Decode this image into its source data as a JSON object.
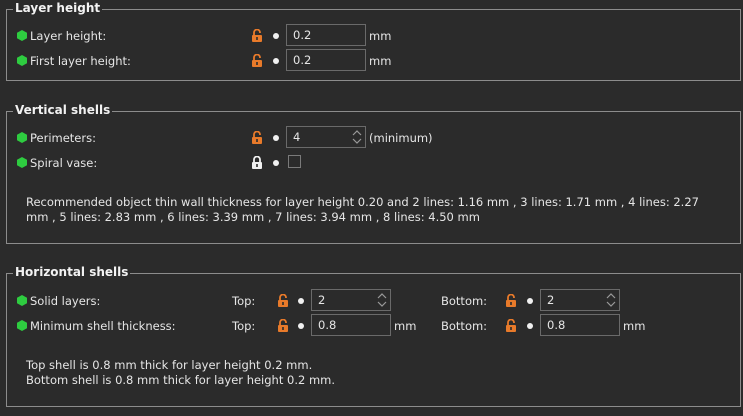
{
  "colors": {
    "accent_green": "#2ecc40",
    "lock_orange": "#e87a2a",
    "lock_white": "#f0f0f0"
  },
  "layer_height": {
    "title": "Layer height",
    "layer_height_label": "Layer height:",
    "layer_height_value": "0.2",
    "layer_height_unit": "mm",
    "first_layer_label": "First layer height:",
    "first_layer_value": "0.2",
    "first_layer_unit": "mm"
  },
  "vertical_shells": {
    "title": "Vertical shells",
    "perimeters_label": "Perimeters:",
    "perimeters_value": "4",
    "perimeters_unit": "(minimum)",
    "spiral_vase_label": "Spiral vase:",
    "note_line1": "Recommended object thin wall thickness for layer height 0.20 and 2 lines: 1.16 mm , 3 lines: 1.71 mm , 4 lines: 2.27",
    "note_line2": "mm , 5 lines: 2.83 mm , 6 lines: 3.39 mm , 7 lines: 3.94 mm , 8 lines: 4.50 mm"
  },
  "horizontal_shells": {
    "title": "Horizontal shells",
    "solid_layers_label": "Solid layers:",
    "top_label": "Top:",
    "bottom_label": "Bottom:",
    "solid_top_value": "2",
    "solid_bottom_value": "2",
    "min_shell_label": "Minimum shell thickness:",
    "min_top_value": "0.8",
    "min_bottom_value": "0.8",
    "unit": "mm",
    "note_line1": "Top shell is 0.8 mm thick for layer height 0.2 mm.",
    "note_line2": "Bottom shell is 0.8 mm thick for layer height 0.2 mm."
  }
}
